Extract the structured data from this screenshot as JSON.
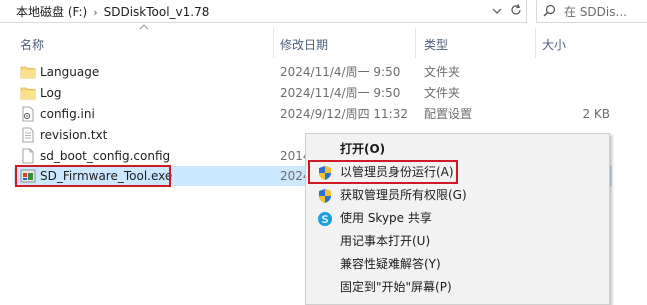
{
  "address": {
    "breadcrumb": [
      "本地磁盘 (F:)",
      "SDDiskTool_v1.78"
    ],
    "separator": "›",
    "search_placeholder": "在 SDDis..."
  },
  "columns": {
    "name": "名称",
    "date": "修改日期",
    "type": "类型",
    "size": "大小"
  },
  "files": [
    {
      "name": "Language",
      "date": "2024/11/4/周一 9:50",
      "type": "文件夹",
      "size": "",
      "icon": "folder-icon"
    },
    {
      "name": "Log",
      "date": "2024/11/4/周一 9:50",
      "type": "文件夹",
      "size": "",
      "icon": "folder-icon"
    },
    {
      "name": "config.ini",
      "date": "2024/9/12/周四 11:32",
      "type": "配置设置",
      "size": "2 KB",
      "icon": "settings-file-icon"
    },
    {
      "name": "revision.txt",
      "date": "",
      "type": "",
      "size": "",
      "icon": "text-file-icon"
    },
    {
      "name": "sd_boot_config.config",
      "date": "2014",
      "type": "",
      "size": "",
      "icon": "blank-file-icon"
    },
    {
      "name": "SD_Firmware_Tool.exe",
      "date": "2024",
      "type": "",
      "size": "",
      "icon": "exe-app-icon",
      "selected": true
    }
  ],
  "context_menu": {
    "items": [
      {
        "label": "打开(O)",
        "icon": "",
        "bold": true
      },
      {
        "label": "以管理员身份运行(A)",
        "icon": "uac-shield-icon"
      },
      {
        "label": "获取管理员所有权限(G)",
        "icon": "uac-shield-icon"
      },
      {
        "label": "使用 Skype 共享",
        "icon": "skype-icon"
      },
      {
        "label": "用记事本打开(U)",
        "icon": ""
      },
      {
        "label": "兼容性疑难解答(Y)",
        "icon": ""
      },
      {
        "label": "固定到\"开始\"屏幕(P)",
        "icon": ""
      }
    ]
  },
  "colors": {
    "selection": "#cce8ff",
    "highlight_border": "#d11b24",
    "header_text": "#4c607a"
  }
}
